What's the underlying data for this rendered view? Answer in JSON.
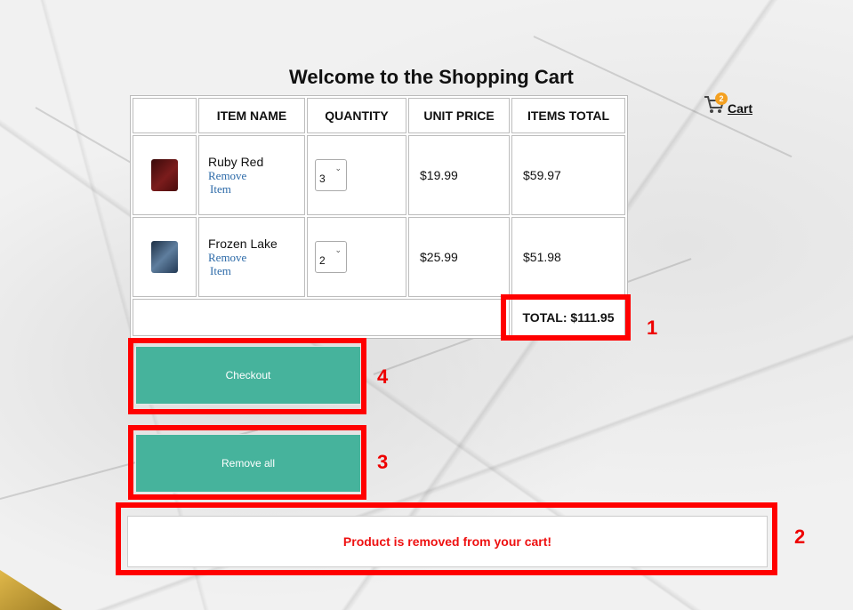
{
  "page": {
    "title": "Welcome to the Shopping Cart"
  },
  "cart_link": {
    "label": "Cart",
    "badge_count": "2",
    "icon": "shopping-cart-icon"
  },
  "table": {
    "headers": [
      "",
      "ITEM NAME",
      "QUANTITY",
      "UNIT PRICE",
      "ITEMS TOTAL"
    ],
    "items": [
      {
        "name": "Ruby Red",
        "remove_label_1": "Remove",
        "remove_label_2": "Item",
        "quantity": "3",
        "unit_price": "$19.99",
        "items_total": "$59.97",
        "thumb_color": "#6e1515"
      },
      {
        "name": "Frozen Lake",
        "remove_label_1": "Remove",
        "remove_label_2": "Item",
        "quantity": "2",
        "unit_price": "$25.99",
        "items_total": "$51.98",
        "thumb_color": "#3b5777"
      }
    ],
    "total_label": "TOTAL: $111.95"
  },
  "buttons": {
    "checkout": "Checkout",
    "remove_all": "Remove all"
  },
  "message": "Product is removed from your cart!",
  "annotations": [
    "1",
    "2",
    "3",
    "4"
  ],
  "colors": {
    "button_bg": "#46b39c",
    "highlight": "#ff0000",
    "message_text": "#ee1111"
  }
}
